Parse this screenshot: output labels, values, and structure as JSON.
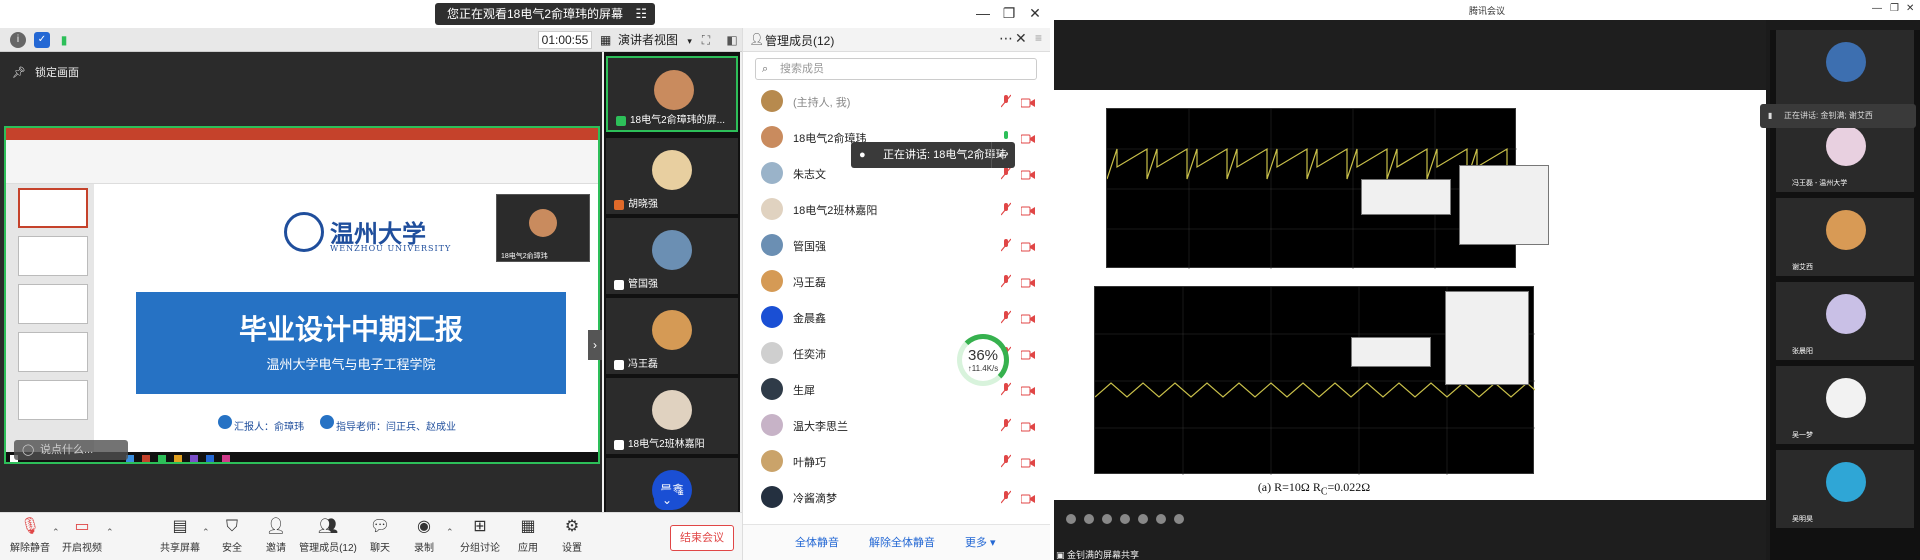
{
  "left_window": {
    "viewing_banner": "您正在观看18电气2俞璋玮的屏幕",
    "timer": "01:00:55",
    "view_mode": "演讲者视图",
    "lock_label": "锁定画面",
    "chat_placeholder": "说点什么...",
    "slide": {
      "logo_text": "温州大学",
      "logo_sub": "WENZHOU UNIVERSITY",
      "title": "毕业设计中期汇报",
      "subtitle": "温州大学电气与电子工程学院",
      "reporter": "汇报人：俞璋玮",
      "advisor": "指导老师：闫正兵、赵成业",
      "mini_video_label": "18电气2俞璋玮"
    },
    "tiles": [
      {
        "name": "18电气2俞璋玮的屏...",
        "avatar_color": "#c98b5e"
      },
      {
        "name": "胡晓强",
        "avatar_color": "#e8cfa0"
      },
      {
        "name": "管国强",
        "avatar_color": "#6b8fb3"
      },
      {
        "name": "冯王磊",
        "avatar_color": "#d59a55"
      },
      {
        "name": "18电气2班林嘉阳",
        "avatar_color": "#e0d2c0"
      },
      {
        "name": "晨鑫",
        "avatar_color": "#1a4fd4"
      }
    ],
    "panel": {
      "title": "管理成员(12)",
      "search_placeholder": "搜索成员",
      "speaking_popup": "正在讲话: 18电气2俞璋玮",
      "net_percent": "36%",
      "net_speed": "↑11.4K/s",
      "members": [
        {
          "name": "(主持人, 我)",
          "avatar_color": "#b78a4e"
        },
        {
          "name": "18电气2俞璋玮",
          "avatar_color": "#c98b5e"
        },
        {
          "name": "朱志文",
          "avatar_color": "#9ab3c9"
        },
        {
          "name": "18电气2班林嘉阳",
          "avatar_color": "#e0d2c0"
        },
        {
          "name": "管国强",
          "avatar_color": "#6b8fb3"
        },
        {
          "name": "冯王磊",
          "avatar_color": "#d59a55"
        },
        {
          "name": "金晨鑫",
          "avatar_color": "#1a4fd4"
        },
        {
          "name": "任奕沛",
          "avatar_color": "#cfcfcf"
        },
        {
          "name": "生犀",
          "avatar_color": "#2f3b48"
        },
        {
          "name": "温大李思兰",
          "avatar_color": "#c7b3c7"
        },
        {
          "name": "叶静巧",
          "avatar_color": "#caa36a"
        },
        {
          "name": "冷酱滴梦",
          "avatar_color": "#243040"
        }
      ],
      "footer": {
        "mute_all": "全体静音",
        "unmute_all": "解除全体静音",
        "more": "更多 ▾"
      }
    },
    "toolbar": {
      "unmute": "解除静音",
      "video": "开启视频",
      "share": "共享屏幕",
      "security": "安全",
      "invite": "邀请",
      "members": "管理成员(12)",
      "chat": "聊天",
      "record": "录制",
      "breakout": "分组讨论",
      "apps": "应用",
      "settings": "设置",
      "end": "结束会议"
    }
  },
  "right_window": {
    "title": "腾讯会议",
    "caption": "(a) R=10Ω  R",
    "caption_sub": "C",
    "caption_tail": "=0.022Ω",
    "speaking_banner": "正在讲话: 金钊满; 谢艾西",
    "status_bar": "金钊满的屏幕共享",
    "tiles": [
      {
        "name": "",
        "avatar_color": "#3d6fb0"
      },
      {
        "name": "冯王磊 - 温州大学",
        "avatar_color": "#e8d0e0"
      },
      {
        "name": "谢艾西",
        "avatar_color": "#d89a55"
      },
      {
        "name": "张晨阳",
        "avatar_color": "#c9c0e6"
      },
      {
        "name": "吴一梦",
        "avatar_color": "#f2f2f2"
      },
      {
        "name": "吴明昊",
        "avatar_color": "#2fa6d6"
      }
    ]
  }
}
